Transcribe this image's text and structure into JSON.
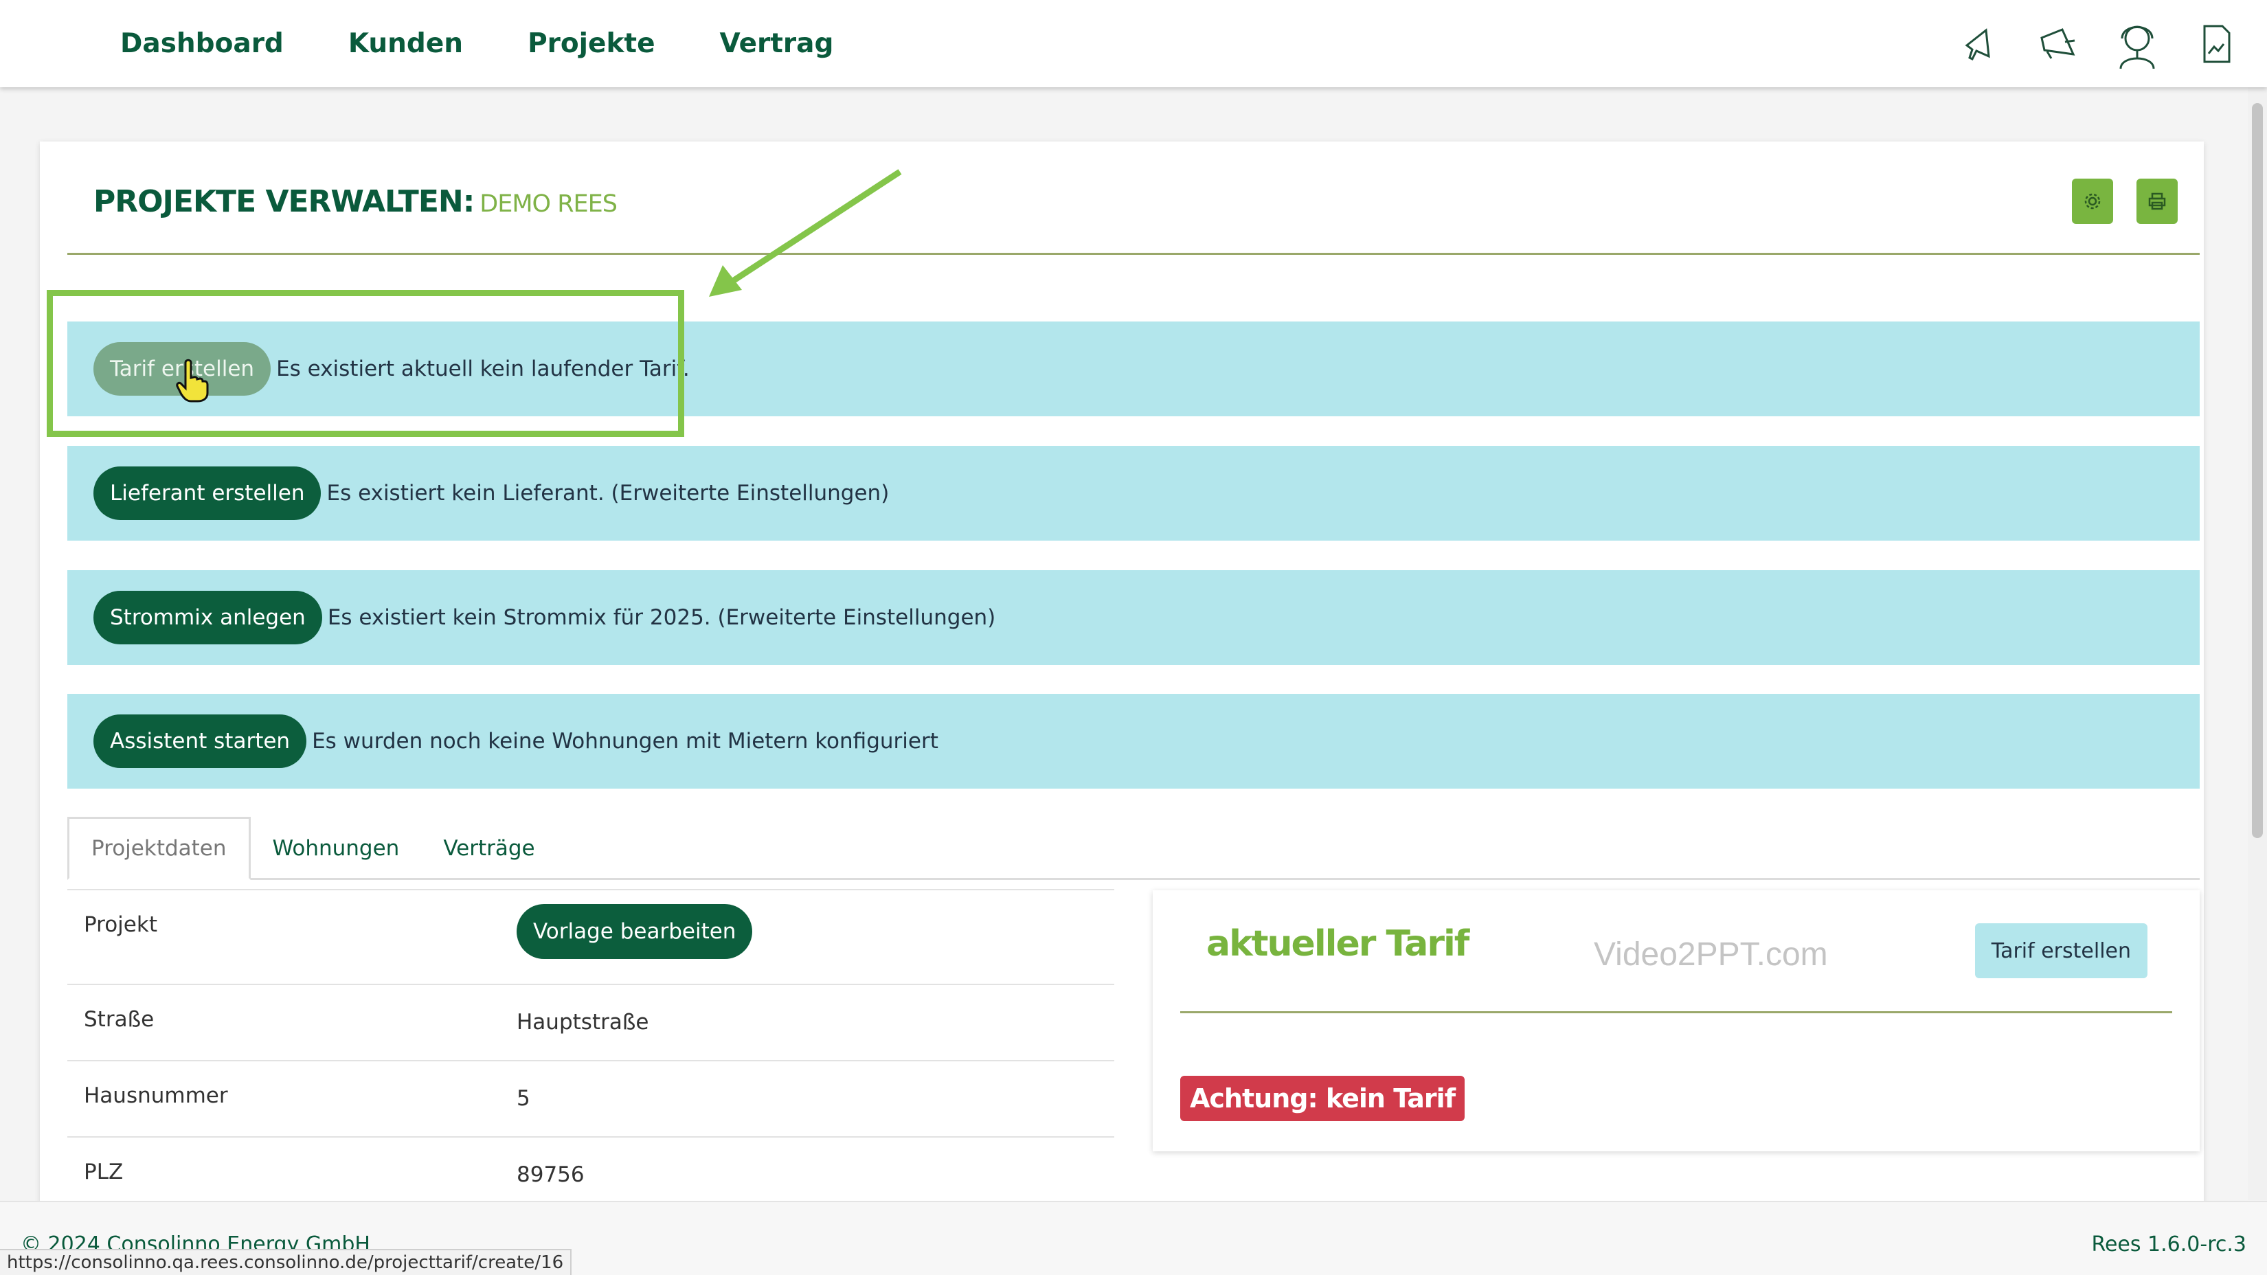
{
  "nav": {
    "items": [
      {
        "label": "Dashboard"
      },
      {
        "label": "Kunden"
      },
      {
        "label": "Projekte"
      },
      {
        "label": "Vertrag"
      }
    ],
    "icons": [
      "megaphone-icon",
      "announcement-icon",
      "user-support-icon",
      "document-icon"
    ]
  },
  "page": {
    "title": "PROJEKTE VERWALTEN:",
    "subtitle": "DEMO REES",
    "actions": [
      "settings-icon",
      "print-icon"
    ]
  },
  "alerts": [
    {
      "button": "Tarif erstellen",
      "text": "Es existiert aktuell kein laufender Tarif."
    },
    {
      "button": "Lieferant erstellen",
      "text": "Es existiert kein Lieferant. (Erweiterte Einstellungen)"
    },
    {
      "button": "Strommix anlegen",
      "text": "Es existiert kein Strommix für 2025. (Erweiterte Einstellungen)"
    },
    {
      "button": "Assistent starten",
      "text": "Es wurden noch keine Wohnungen mit Mietern konfiguriert"
    }
  ],
  "tabs": [
    {
      "label": "Projektdaten",
      "active": true
    },
    {
      "label": "Wohnungen",
      "active": false
    },
    {
      "label": "Verträge",
      "active": false
    }
  ],
  "project": {
    "rows": [
      {
        "label": "Projekt",
        "button": "Vorlage bearbeiten"
      },
      {
        "label": "Straße",
        "value": "Hauptstraße"
      },
      {
        "label": "Hausnummer",
        "value": "5"
      },
      {
        "label": "PLZ",
        "value": "89756"
      }
    ]
  },
  "tarif": {
    "title": "aktueller Tarif",
    "watermark": "Video2PPT.com",
    "button": "Tarif erstellen",
    "warning": "Achtung: kein Tarif"
  },
  "footer": {
    "copyright": "© 2024 Consolinno Energy GmbH",
    "version": "Rees 1.6.0-rc.3",
    "status_url": "https://consolinno.qa.rees.consolinno.de/projecttarif/create/16"
  },
  "colors": {
    "primary": "#0c5e3d",
    "accent": "#79b540",
    "alert_bg": "#b3e6ec",
    "danger": "#d13b4b"
  }
}
